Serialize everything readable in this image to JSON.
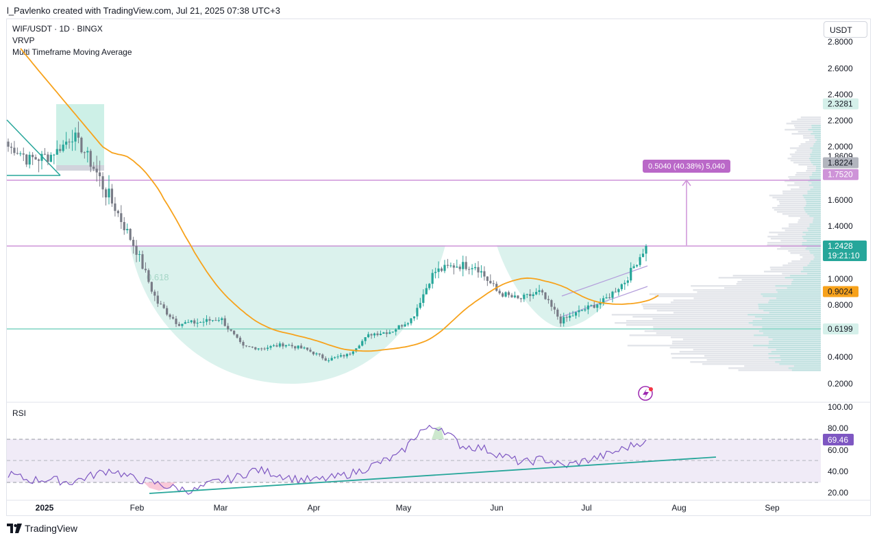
{
  "header": {
    "attribution": "l_Pavlenko created with TradingView.com, Jul 21, 2025 07:38 UTC+3"
  },
  "legend": {
    "symbol": "WIF/USDT · 1D · BINGX",
    "indicator1": "VRVP",
    "indicator2": "Multi Timeframe Moving Average"
  },
  "currency_button": "USDT",
  "rsi": {
    "label": "RSI",
    "current_value": "69.46",
    "ticks": [
      "100.00",
      "80.00",
      "60.00",
      "40.00",
      "20.00"
    ]
  },
  "measure_label": "0.5040 (40.38%) 5,040",
  "fib_label": "0.618",
  "footer": {
    "brand": "TradingView"
  },
  "colors": {
    "bull": "#26a69a",
    "bear": "#787b86",
    "ma": "#f7a21b",
    "cup_fill": "#d5f0ea",
    "level_purple": "#ce93d8",
    "level_green": "#7fd3c2",
    "rsi_line": "#7e57c2",
    "rsi_band": "#ede7f6",
    "trend_teal": "#26a69a"
  },
  "chart_data": [
    {
      "type": "candlestick",
      "title": "WIF/USDT · 1D · BINGX",
      "x_axis_labels": [
        "2025",
        "Feb",
        "Mar",
        "Apr",
        "May",
        "Jun",
        "Jul",
        "Aug",
        "Sep"
      ],
      "y_axis_ticks": [
        "2.8000",
        "2.6000",
        "2.4000",
        "2.2000",
        "2.0000",
        "1.8609",
        "1.6000",
        "1.4000",
        "1.0000",
        "0.8000",
        "0.4000",
        "0.2000"
      ],
      "price_labels": [
        {
          "value": "2.3281",
          "style": "teal-light"
        },
        {
          "value": "1.8224",
          "style": "gray"
        },
        {
          "value": "1.7520",
          "style": "purple"
        },
        {
          "value": "1.2428",
          "style": "current",
          "countdown": "19:21:10"
        },
        {
          "value": "0.9024",
          "style": "ma"
        },
        {
          "value": "0.6199",
          "style": "teal-light"
        }
      ],
      "horizontal_levels": [
        1.752,
        1.2428,
        0.6199
      ],
      "moving_average_current": 0.9024,
      "last_close": 1.2428,
      "approx_closes": {
        "dates": [
          "Dec 25",
          "Jan 1",
          "Jan 8",
          "Jan 15",
          "Jan 20",
          "Jan 27",
          "Feb 3",
          "Feb 10",
          "Feb 17",
          "Feb 24",
          "Mar 3",
          "Mar 10",
          "Mar 17",
          "Mar 24",
          "Mar 31",
          "Apr 7",
          "Apr 14",
          "Apr 21",
          "Apr 28",
          "May 5",
          "May 12",
          "May 19",
          "May 26",
          "Jun 2",
          "Jun 9",
          "Jun 16",
          "Jun 23",
          "Jun 30",
          "Jul 7",
          "Jul 14",
          "Jul 21"
        ],
        "close": [
          2.0,
          1.84,
          1.88,
          2.1,
          1.8,
          1.55,
          1.22,
          0.82,
          0.66,
          0.67,
          0.7,
          0.48,
          0.47,
          0.5,
          0.46,
          0.38,
          0.42,
          0.58,
          0.6,
          0.7,
          1.05,
          1.1,
          1.1,
          0.9,
          0.84,
          0.9,
          0.68,
          0.76,
          0.83,
          0.98,
          1.2428
        ]
      }
    },
    {
      "type": "line",
      "title": "RSI",
      "y_range": [
        0,
        100
      ],
      "bands": [
        30,
        70
      ],
      "current": 69.46,
      "approx_values": [
        38,
        32,
        33,
        30,
        36,
        42,
        34,
        30,
        25,
        22,
        30,
        34,
        42,
        38,
        33,
        32,
        35,
        40,
        48,
        55,
        78,
        82,
        64,
        62,
        55,
        48,
        52,
        45,
        50,
        55,
        62,
        69.46
      ]
    }
  ]
}
